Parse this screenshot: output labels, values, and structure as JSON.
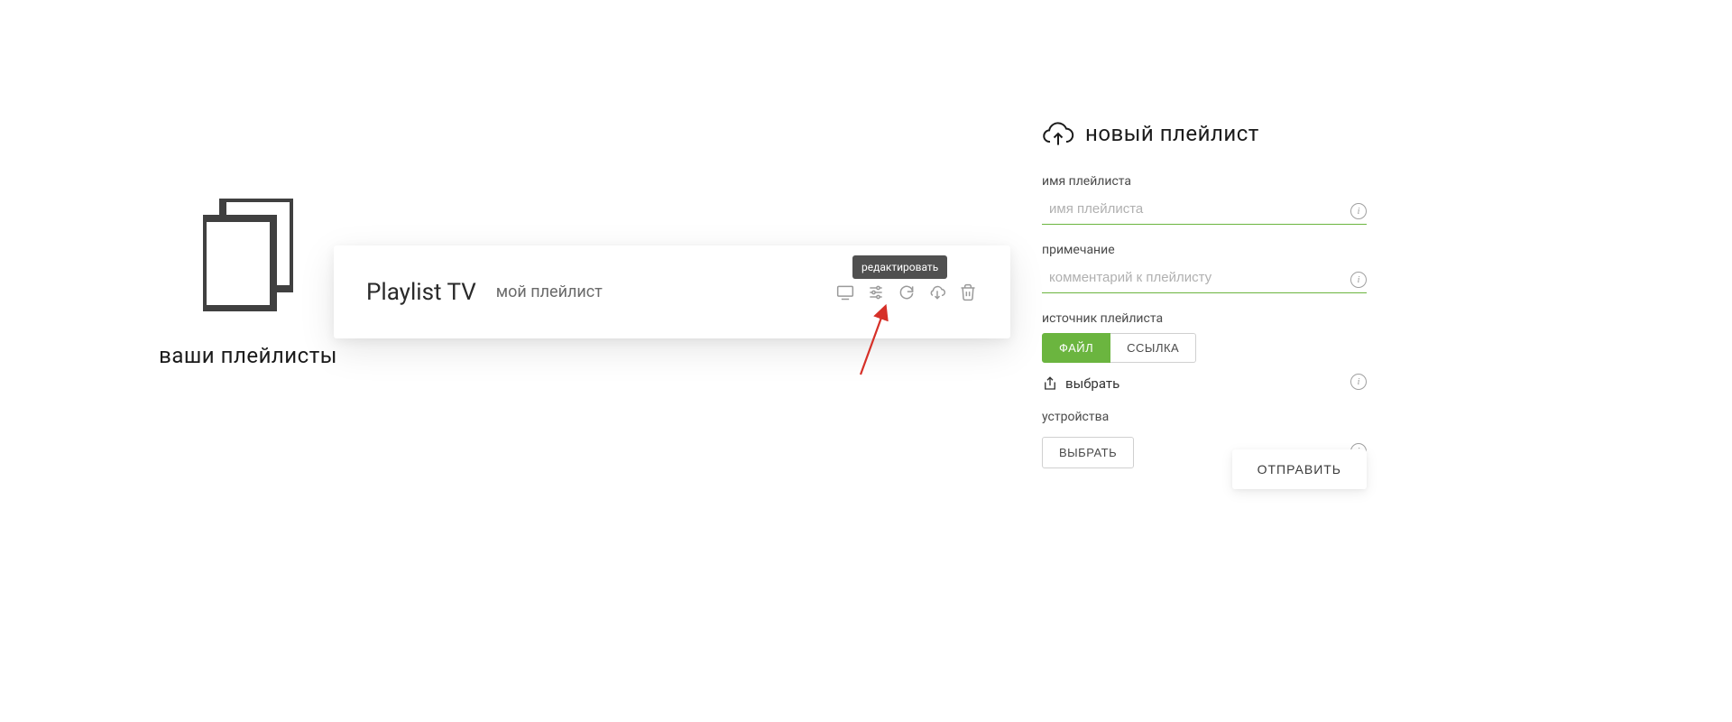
{
  "left": {
    "title": "ваши плейлисты"
  },
  "card": {
    "title": "Playlist TV",
    "subtitle": "мой плейлист",
    "tooltip": "редактировать",
    "icons": {
      "monitor": "monitor-icon",
      "settings": "sliders-icon",
      "refresh": "refresh-icon",
      "cloud": "cloud-download-icon",
      "delete": "trash-icon"
    }
  },
  "panel": {
    "title": "новый плейлист",
    "fields": {
      "name": {
        "label": "имя плейлиста",
        "placeholder": "имя плейлиста"
      },
      "note": {
        "label": "примечание",
        "placeholder": "комментарий к плейлисту"
      },
      "source": {
        "label": "источник плейлиста",
        "file": "ФАЙЛ",
        "link": "ССЫЛКА"
      },
      "choose": "выбрать",
      "devices": {
        "label": "устройства",
        "button": "ВЫБРАТЬ"
      }
    },
    "submit": "ОТПРАВИТЬ"
  }
}
